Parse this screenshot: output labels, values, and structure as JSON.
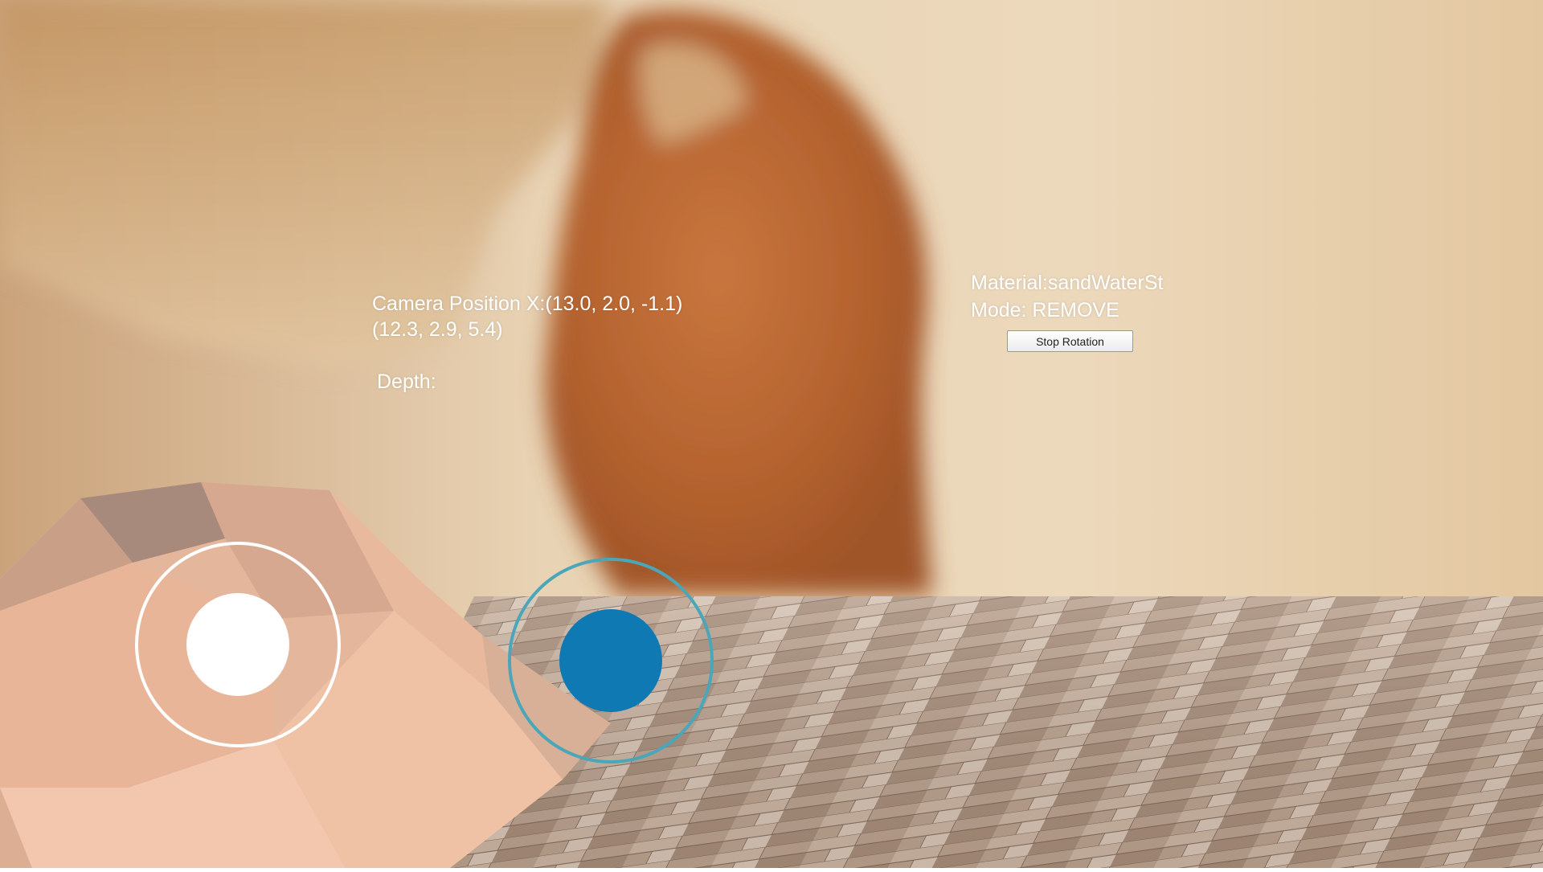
{
  "hud": {
    "camera_position_line1": "Camera Position X:(13.0, 2.0, -1.1)",
    "camera_position_line2": "(12.3, 2.9, 5.4)",
    "depth_label": "Depth:",
    "material_label": "Material:sandWaterSt",
    "mode_label": "Mode: REMOVE",
    "stop_rotation_label": "Stop Rotation"
  },
  "joysticks": {
    "left_name": "movement-joystick",
    "right_name": "look-joystick"
  },
  "colors": {
    "wall": "#e4ccaa",
    "hand": "#b8652e",
    "floor_wood": "#b89e8a",
    "terrain": "#e8b89c",
    "joystick_white": "#ffffff",
    "joystick_ring_teal": "#4aa6b8",
    "joystick_knob_blue": "#0f79b3"
  }
}
